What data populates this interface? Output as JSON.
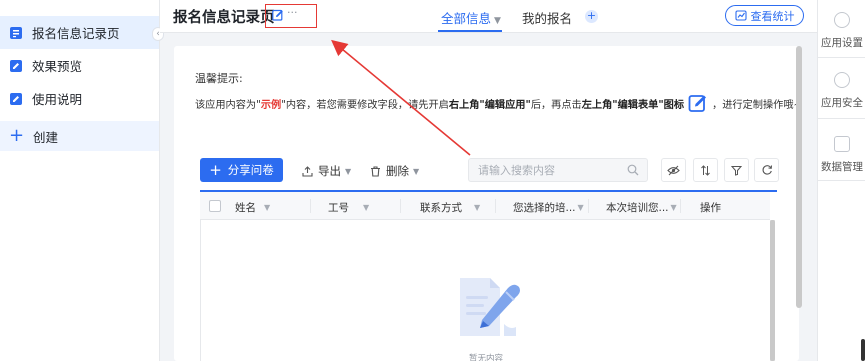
{
  "sidebar": {
    "items": [
      {
        "label": "报名信息记录页",
        "icon": "form-icon"
      },
      {
        "label": "效果预览",
        "icon": "edit-icon"
      },
      {
        "label": "使用说明",
        "icon": "edit-icon"
      }
    ],
    "create_label": "创建",
    "collapse_glyph": "‹"
  },
  "header": {
    "title": "报名信息记录页",
    "more_glyph": "···",
    "tabs": [
      {
        "label": "全部信息",
        "active": true
      },
      {
        "label": "我的报名",
        "active": false
      }
    ],
    "add_tab_glyph": "+",
    "stats_label": "查看统计"
  },
  "right_panel": {
    "items": [
      {
        "label": "应用设置",
        "icon": "gear-icon"
      },
      {
        "label": "应用安全",
        "icon": "shield-icon"
      },
      {
        "label": "数据管理",
        "icon": "database-icon"
      }
    ]
  },
  "hint": {
    "title": "温馨提示:",
    "t1": "该应用内容为\"",
    "t2": "示例",
    "t3": "\"内容，若您需要修改字段，请先开启",
    "t4": "右上角\"编辑应用\"",
    "t5": "后，再点击",
    "t6": "左上角\"编辑表单\"图标",
    "t7": "，进行定制操作哦~"
  },
  "toolbar": {
    "share_label": "分享问卷",
    "export_label": "导出",
    "delete_label": "删除",
    "search_placeholder": "请输入搜索内容"
  },
  "table": {
    "columns": [
      "姓名",
      "工号",
      "联系方式",
      "您选择的培...",
      "本次培训您...",
      "操作"
    ],
    "empty_text": "暂无内容"
  },
  "colors": {
    "accent": "#2c6cf0",
    "annotation": "#e53935"
  }
}
